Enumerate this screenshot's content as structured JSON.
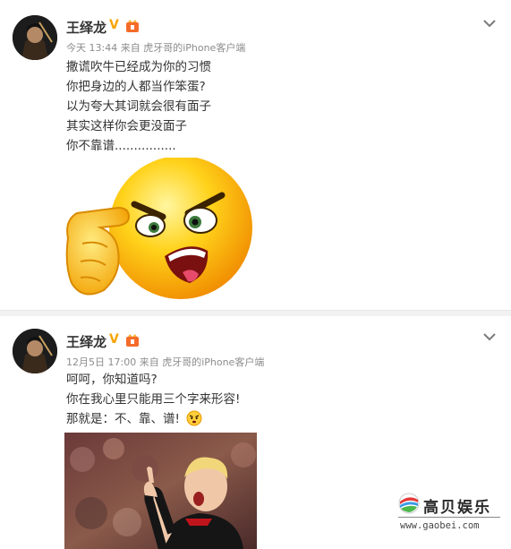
{
  "posts": [
    {
      "username": "王绎龙",
      "verified_icon": "V",
      "timestamp": "今天 13:44",
      "source": "来自 虎牙哥的iPhone客户端",
      "lines": [
        "撒谎吹牛已经成为你的习惯",
        "你把身边的人都当作笨蛋?",
        "以为夸大其词就会很有面子",
        "其实这样你会更没面子",
        "你不靠谱................"
      ],
      "image_icon": "angry-emoji-pointing-image"
    },
    {
      "username": "王绎龙",
      "verified_icon": "V",
      "timestamp": "12月5日 17:00",
      "source": "来自 虎牙哥的iPhone客户端",
      "lines": [
        "呵呵，你知道吗?",
        "你在我心里只能用三个字来形容!",
        "那就是：不、靠、谱!"
      ],
      "image_icon": "pointing-boy-photo"
    }
  ],
  "watermark": {
    "title": "高贝娱乐",
    "url": "www.gaobei.com"
  },
  "colors": {
    "verified": "#f7a400",
    "meta": "#8c8c8c",
    "text": "#333333"
  }
}
